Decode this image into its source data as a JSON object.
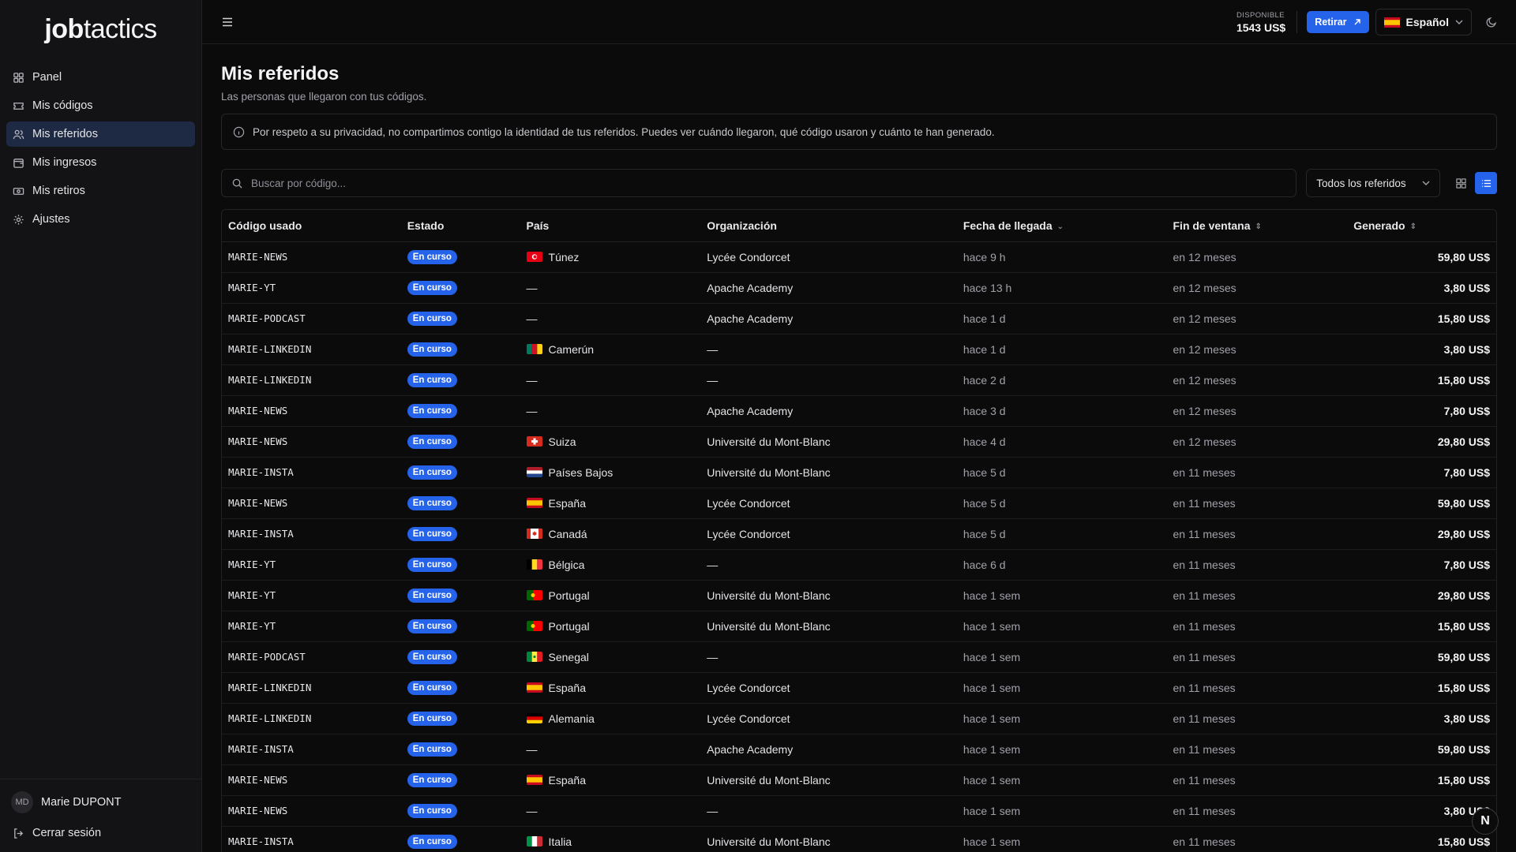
{
  "app": {
    "logo_bold": "job",
    "logo_light": "tactics"
  },
  "sidebar": {
    "items": [
      {
        "label": "Panel",
        "icon": "dashboard-icon"
      },
      {
        "label": "Mis códigos",
        "icon": "ticket-icon"
      },
      {
        "label": "Mis referidos",
        "icon": "users-icon",
        "active": true
      },
      {
        "label": "Mis ingresos",
        "icon": "wallet-icon"
      },
      {
        "label": "Mis retiros",
        "icon": "banknote-icon"
      },
      {
        "label": "Ajustes",
        "icon": "gear-icon"
      }
    ],
    "user": {
      "initials": "MD",
      "name": "Marie DUPONT"
    },
    "logout_label": "Cerrar sesión"
  },
  "header": {
    "balance_label": "DISPONIBLE",
    "balance_value": "1543 US$",
    "withdraw_label": "Retirar",
    "language_label": "Español"
  },
  "main": {
    "title": "Mis referidos",
    "subtitle": "Las personas que llegaron con tus códigos.",
    "notice": "Por respeto a su privacidad, no compartimos contigo la identidad de tus referidos. Puedes ver cuándo llegaron, qué código usaron y cuánto te han generado.",
    "search_placeholder": "Buscar por código...",
    "filter_label": "Todos los referidos"
  },
  "table": {
    "columns": [
      "Código usado",
      "Estado",
      "País",
      "Organización",
      "Fecha de llegada",
      "Fin de ventana",
      "Generado"
    ],
    "rows": [
      {
        "code": "MARIE-NEWS",
        "status": "En curso",
        "flag": "tn",
        "country": "Túnez",
        "org": "Lycée Condorcet",
        "arrival": "hace 9 h",
        "end": "en 12 meses",
        "amount": "59,80 US$"
      },
      {
        "code": "MARIE-YT",
        "status": "En curso",
        "flag": "",
        "country": "—",
        "org": "Apache Academy",
        "arrival": "hace 13 h",
        "end": "en 12 meses",
        "amount": "3,80 US$"
      },
      {
        "code": "MARIE-PODCAST",
        "status": "En curso",
        "flag": "",
        "country": "—",
        "org": "Apache Academy",
        "arrival": "hace 1 d",
        "end": "en 12 meses",
        "amount": "15,80 US$"
      },
      {
        "code": "MARIE-LINKEDIN",
        "status": "En curso",
        "flag": "cm",
        "country": "Camerún",
        "org": "—",
        "arrival": "hace 1 d",
        "end": "en 12 meses",
        "amount": "3,80 US$"
      },
      {
        "code": "MARIE-LINKEDIN",
        "status": "En curso",
        "flag": "",
        "country": "—",
        "org": "—",
        "arrival": "hace 2 d",
        "end": "en 12 meses",
        "amount": "15,80 US$"
      },
      {
        "code": "MARIE-NEWS",
        "status": "En curso",
        "flag": "",
        "country": "—",
        "org": "Apache Academy",
        "arrival": "hace 3 d",
        "end": "en 12 meses",
        "amount": "7,80 US$"
      },
      {
        "code": "MARIE-NEWS",
        "status": "En curso",
        "flag": "ch",
        "country": "Suiza",
        "org": "Université du Mont-Blanc",
        "arrival": "hace 4 d",
        "end": "en 12 meses",
        "amount": "29,80 US$"
      },
      {
        "code": "MARIE-INSTA",
        "status": "En curso",
        "flag": "nl",
        "country": "Países Bajos",
        "org": "Université du Mont-Blanc",
        "arrival": "hace 5 d",
        "end": "en 11 meses",
        "amount": "7,80 US$"
      },
      {
        "code": "MARIE-NEWS",
        "status": "En curso",
        "flag": "es",
        "country": "España",
        "org": "Lycée Condorcet",
        "arrival": "hace 5 d",
        "end": "en 11 meses",
        "amount": "59,80 US$"
      },
      {
        "code": "MARIE-INSTA",
        "status": "En curso",
        "flag": "ca",
        "country": "Canadá",
        "org": "Lycée Condorcet",
        "arrival": "hace 5 d",
        "end": "en 11 meses",
        "amount": "29,80 US$"
      },
      {
        "code": "MARIE-YT",
        "status": "En curso",
        "flag": "be",
        "country": "Bélgica",
        "org": "—",
        "arrival": "hace 6 d",
        "end": "en 11 meses",
        "amount": "7,80 US$"
      },
      {
        "code": "MARIE-YT",
        "status": "En curso",
        "flag": "pt",
        "country": "Portugal",
        "org": "Université du Mont-Blanc",
        "arrival": "hace 1 sem",
        "end": "en 11 meses",
        "amount": "29,80 US$"
      },
      {
        "code": "MARIE-YT",
        "status": "En curso",
        "flag": "pt",
        "country": "Portugal",
        "org": "Université du Mont-Blanc",
        "arrival": "hace 1 sem",
        "end": "en 11 meses",
        "amount": "15,80 US$"
      },
      {
        "code": "MARIE-PODCAST",
        "status": "En curso",
        "flag": "sn",
        "country": "Senegal",
        "org": "—",
        "arrival": "hace 1 sem",
        "end": "en 11 meses",
        "amount": "59,80 US$"
      },
      {
        "code": "MARIE-LINKEDIN",
        "status": "En curso",
        "flag": "es",
        "country": "España",
        "org": "Lycée Condorcet",
        "arrival": "hace 1 sem",
        "end": "en 11 meses",
        "amount": "15,80 US$"
      },
      {
        "code": "MARIE-LINKEDIN",
        "status": "En curso",
        "flag": "de",
        "country": "Alemania",
        "org": "Lycée Condorcet",
        "arrival": "hace 1 sem",
        "end": "en 11 meses",
        "amount": "3,80 US$"
      },
      {
        "code": "MARIE-INSTA",
        "status": "En curso",
        "flag": "",
        "country": "—",
        "org": "Apache Academy",
        "arrival": "hace 1 sem",
        "end": "en 11 meses",
        "amount": "59,80 US$"
      },
      {
        "code": "MARIE-NEWS",
        "status": "En curso",
        "flag": "es",
        "country": "España",
        "org": "Université du Mont-Blanc",
        "arrival": "hace 1 sem",
        "end": "en 11 meses",
        "amount": "15,80 US$"
      },
      {
        "code": "MARIE-NEWS",
        "status": "En curso",
        "flag": "",
        "country": "—",
        "org": "—",
        "arrival": "hace 1 sem",
        "end": "en 11 meses",
        "amount": "3,80 US$"
      },
      {
        "code": "MARIE-INSTA",
        "status": "En curso",
        "flag": "it",
        "country": "Italia",
        "org": "Université du Mont-Blanc",
        "arrival": "hace 1 sem",
        "end": "en 11 meses",
        "amount": "15,80 US$"
      }
    ]
  },
  "fab_label": "N",
  "colors": {
    "accent": "#2563eb",
    "background": "#0b0b0c",
    "sidebar": "#131315",
    "active_nav": "#1e2a44"
  }
}
